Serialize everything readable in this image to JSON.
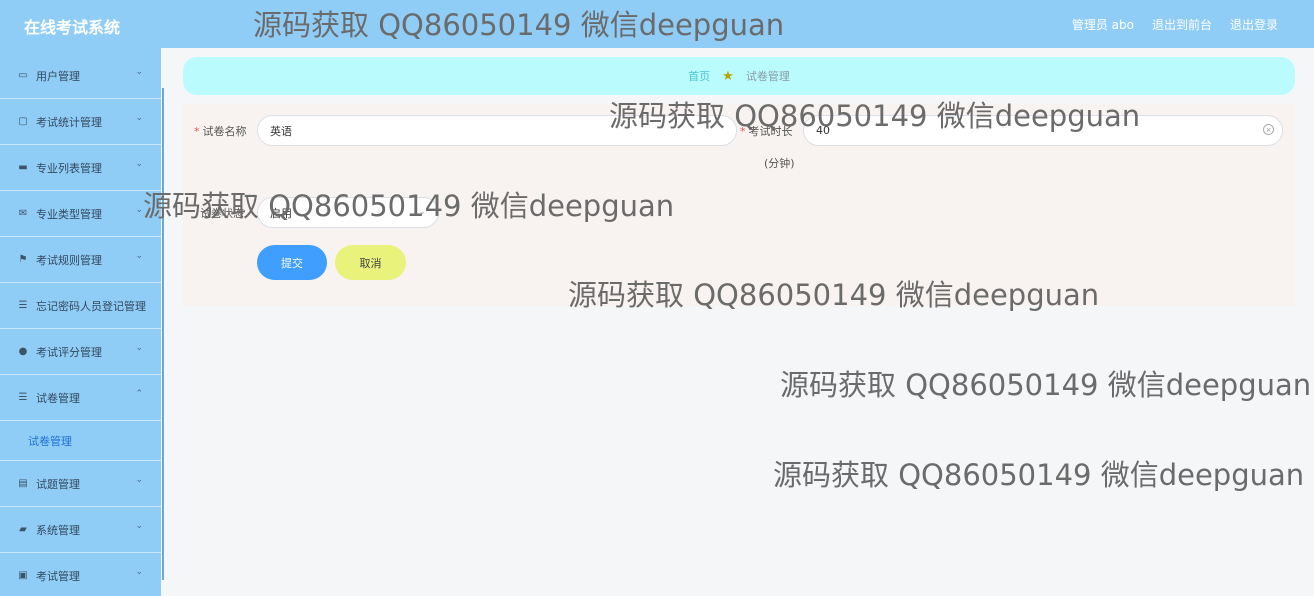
{
  "header": {
    "app_title": "在线考试系统",
    "admin_label": "管理员 abo",
    "back_frontend": "退出到前台",
    "logout": "退出登录"
  },
  "sidebar": {
    "items": [
      {
        "label": "用户管理",
        "icon": "user-card-icon",
        "glyph": "▭",
        "chevron": "⌄"
      },
      {
        "label": "考试统计管理",
        "icon": "chat-icon",
        "glyph": "▢",
        "chevron": "⌄"
      },
      {
        "label": "专业列表管理",
        "icon": "monitor-icon",
        "glyph": "▬",
        "chevron": "⌄"
      },
      {
        "label": "专业类型管理",
        "icon": "mail-icon",
        "glyph": "✉",
        "chevron": "⌄"
      },
      {
        "label": "考试规则管理",
        "icon": "flag-icon",
        "glyph": "⚑",
        "chevron": "⌄"
      },
      {
        "label": "忘记密码人员登记管理",
        "icon": "list-icon",
        "glyph": "☰",
        "chevron": ""
      },
      {
        "label": "考试评分管理",
        "icon": "person-icon",
        "glyph": "●",
        "chevron": "⌄"
      },
      {
        "label": "试卷管理",
        "icon": "list-icon",
        "glyph": "☰",
        "chevron": "⌃"
      },
      {
        "label": "试题管理",
        "icon": "clipboard-icon",
        "glyph": "▤",
        "chevron": "⌄"
      },
      {
        "label": "系统管理",
        "icon": "briefcase-icon",
        "glyph": "▰",
        "chevron": "⌄"
      },
      {
        "label": "考试管理",
        "icon": "comment-icon",
        "glyph": "▣",
        "chevron": "⌄"
      }
    ],
    "submenu_label": "试卷管理"
  },
  "breadcrumb": {
    "home": "首页",
    "star": "★",
    "current": "试卷管理"
  },
  "form": {
    "name_label": "试卷名称",
    "name_value": "英语",
    "duration_label": "考试时长",
    "duration_value": "40",
    "duration_unit": "(分钟)",
    "status_label": "试卷状态",
    "status_value": "启用",
    "required_mark": "*",
    "clear_glyph": "×",
    "select_chevron": "⌄"
  },
  "buttons": {
    "submit": "提交",
    "cancel": "取消"
  },
  "watermarks": [
    "源码获取 QQ86050149 微信deepguan",
    "源码获取 QQ86050149 微信deepguan",
    "源码获取 QQ86050149 微信deepguan",
    "源码获取 QQ86050149 微信deepguan",
    "源码获取 QQ86050149 微信deepguan",
    "源码获取 QQ86050149 微信deepguan"
  ]
}
